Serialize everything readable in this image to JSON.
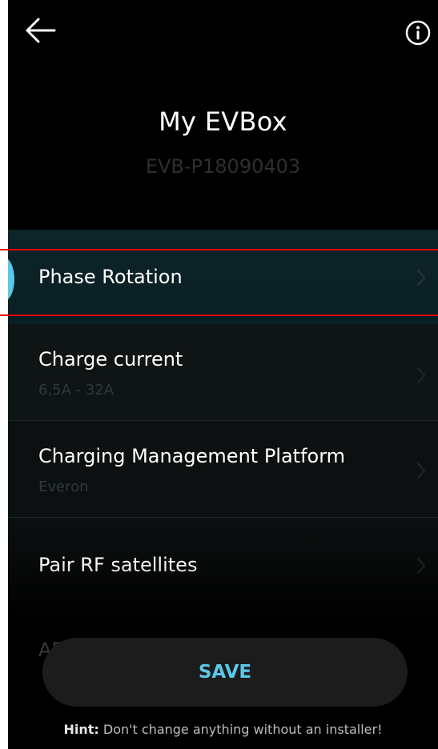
{
  "header": {
    "back_icon": "arrow-left-icon",
    "info_icon": "info-circle-icon",
    "title": "My EVBox",
    "serial": "EVB-P18090403"
  },
  "settings": {
    "items": [
      {
        "label": "Phase Rotation",
        "sub": "",
        "selected": true
      },
      {
        "label": "Charge current",
        "sub": "6,5A - 32A"
      },
      {
        "label": "Charging Management Platform",
        "sub": "Everon"
      },
      {
        "label": "Pair RF satellites",
        "sub": ""
      },
      {
        "label": "AE",
        "sub": ""
      }
    ],
    "chevron_icon": "chevron-right-icon"
  },
  "footer": {
    "save_label": "SAVE",
    "hint_prefix": "Hint:",
    "hint_text": " Don't change anything without an installer!"
  },
  "colors": {
    "background": "#000000",
    "accent": "#5ac8e6",
    "highlight_outline": "#e00000"
  }
}
